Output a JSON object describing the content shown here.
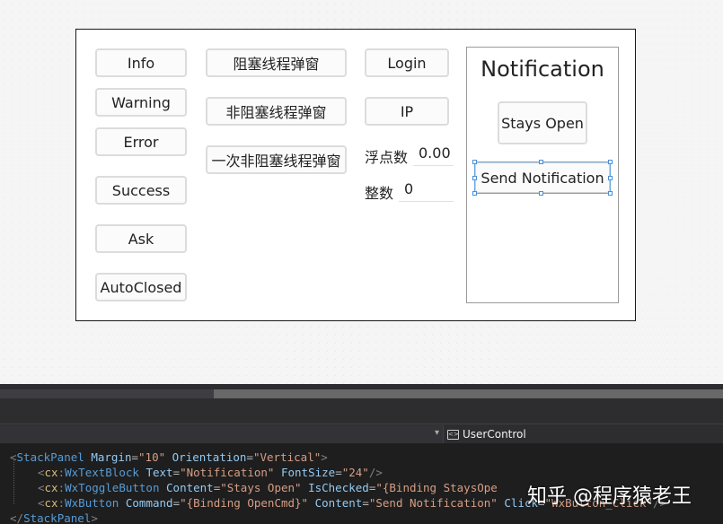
{
  "left_buttons": [
    "Info",
    "Warning",
    "Error",
    "Success",
    "Ask",
    "AutoClosed"
  ],
  "middle_buttons": [
    "阻塞线程弹窗",
    "非阻塞线程弹窗",
    "一次非阻塞线程弹窗"
  ],
  "right_buttons": {
    "login": "Login",
    "ip": "IP"
  },
  "fields": {
    "float_label": "浮点数",
    "float_value": "0.00",
    "int_label": "整数",
    "int_value": "0"
  },
  "notification": {
    "title": "Notification",
    "toggle_label": "Stays Open",
    "send_label": "Send Notification"
  },
  "navbar": {
    "right_label": "UserControl"
  },
  "code": {
    "l1": {
      "tag": "StackPanel",
      "a1": "Margin",
      "v1": "\"10\"",
      "a2": "Orientation",
      "v2": "\"Vertical\""
    },
    "l2": {
      "ns": "cx",
      "tag": "WxTextBlock",
      "a1": "Text",
      "v1": "\"Notification\"",
      "a2": "FontSize",
      "v2": "\"24\""
    },
    "l3": {
      "ns": "cx",
      "tag": "WxToggleButton",
      "a1": "Content",
      "v1": "\"Stays Open\"",
      "a2": "IsChecked",
      "v2": "\"{Binding StaysOpe"
    },
    "l4": {
      "ns": "cx",
      "tag": "WxButton",
      "a1": "Command",
      "v1": "\"{Binding OpenCmd}\"",
      "a2": "Content",
      "v2": "\"Send Notification\"",
      "a3": "Click",
      "v3": "\"WxButton_Click\""
    },
    "l5": {
      "tag": "StackPanel"
    }
  },
  "watermark": "知乎 @程序猿老王",
  "colors": {
    "selection": "#4a8fd6",
    "code_bg": "#1e1e1e",
    "tag": "#569cd6",
    "string": "#d69d85"
  }
}
